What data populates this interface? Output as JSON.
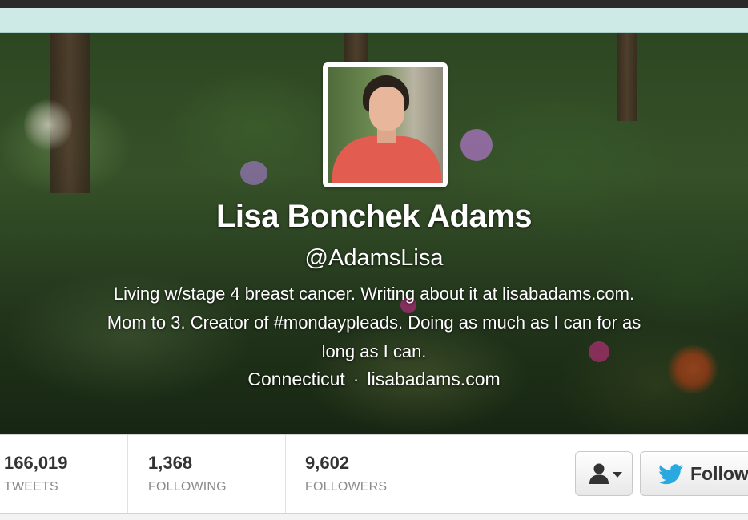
{
  "profile": {
    "name": "Lisa Bonchek Adams",
    "screen_name": "@AdamsLisa",
    "bio_lines": [
      "Living w/stage 4 breast cancer. Writing about it at lisabadams.com.",
      "Mom to 3. Creator of #mondaypleads. Doing as much as I can for as",
      "long as I can."
    ],
    "location": "Connecticut",
    "separator": "·",
    "website": "lisabadams.com"
  },
  "stats": {
    "tweets": {
      "value": "166,019",
      "label": "TWEETS"
    },
    "following": {
      "value": "1,368",
      "label": "FOLLOWING"
    },
    "followers": {
      "value": "9,602",
      "label": "FOLLOWERS"
    }
  },
  "actions": {
    "follow_label": "Follow",
    "user_menu_icon": "user-dropdown-icon",
    "follow_icon": "twitter-bird-icon"
  },
  "colors": {
    "accent_strip": "#cdeae6",
    "twitter_blue": "#2aa9e0",
    "avatar_shirt": "#e25c4f"
  }
}
